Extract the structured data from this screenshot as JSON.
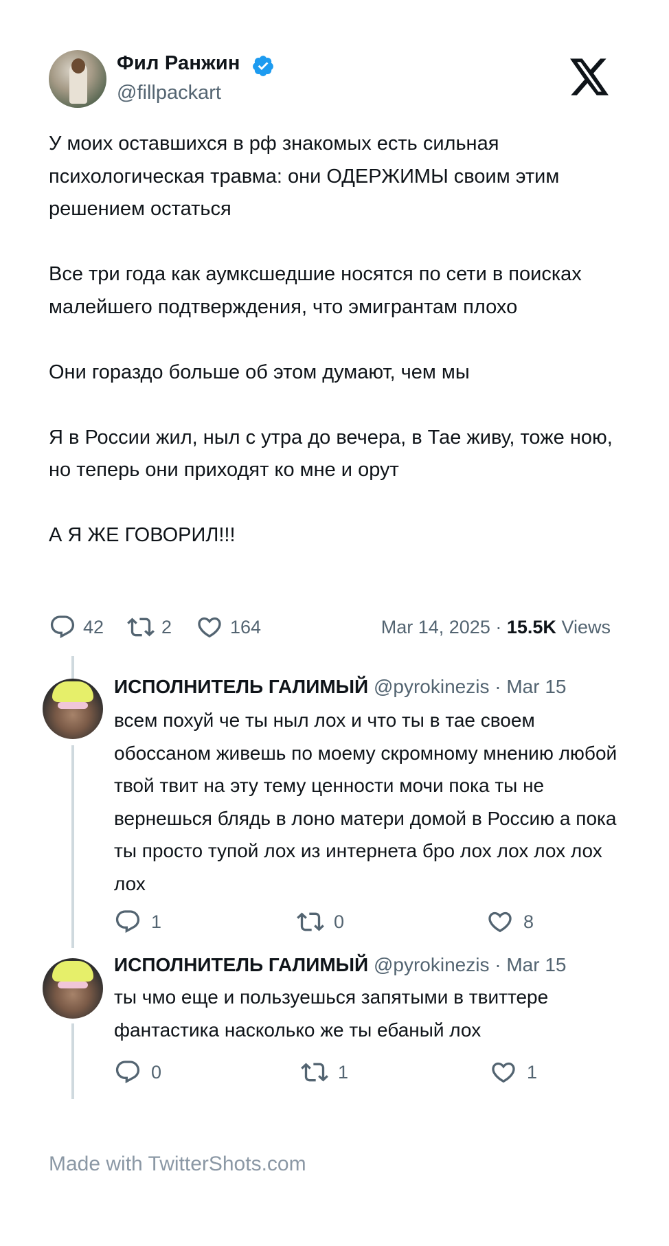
{
  "author": {
    "name": "Фил Ранжин",
    "handle": "@fillpackart",
    "verified": true,
    "verified_color": "#1d9bf0"
  },
  "platform_icon": "x-logo-icon",
  "tweet": {
    "text": "У моих оставшихся в рф знакомых есть сильная психологическая травма: они ОДЕРЖИМЫ своим этим решением остаться\n\nВсе три года как аумксшедшие носятся по сети в поисках малейшего подтверждения, что эмигрантам плохо\n\nОни гораздо больше об этом думают, чем мы\n\nЯ в России жил, ныл с утра до вечера, в Тае живу, тоже ною, но теперь они приходят ко мне и орут\n\nА Я ЖЕ ГОВОРИЛ!!!",
    "replies": "42",
    "retweets": "2",
    "likes": "164",
    "date": "Mar 14, 2025",
    "separator": "·",
    "views_count": "15.5K",
    "views_label": "Views"
  },
  "replies": [
    {
      "name": "ИСПОЛНИТЕЛЬ ГАЛИМЫЙ",
      "handle": "@pyrokinezis",
      "date": "· Mar 15",
      "text": "всем похуй че ты ныл лох и что ты в тае своем обоссаном живешь по моему скромному мнению любой твой твит на эту тему ценности мочи пока ты не вернешься блядь в лоно матери домой в Россию а пока ты просто тупой лох из интернета бро лох лох лох лох лох",
      "replies": "1",
      "retweets": "0",
      "likes": "8"
    },
    {
      "name": "ИСПОЛНИТЕЛЬ ГАЛИМЫЙ",
      "handle": "@pyrokinezis",
      "date": "· Mar 15",
      "text": "ты чмо еще и пользуешься запятыми в твиттере фантастика  насколько же ты ебаный лох",
      "replies": "0",
      "retweets": "1",
      "likes": "1"
    }
  ],
  "footer": "Made with TwitterShots.com",
  "colors": {
    "text": "#0f1419",
    "muted": "#536471",
    "thread_line": "#cfd9de",
    "footer": "#8b98a5"
  }
}
